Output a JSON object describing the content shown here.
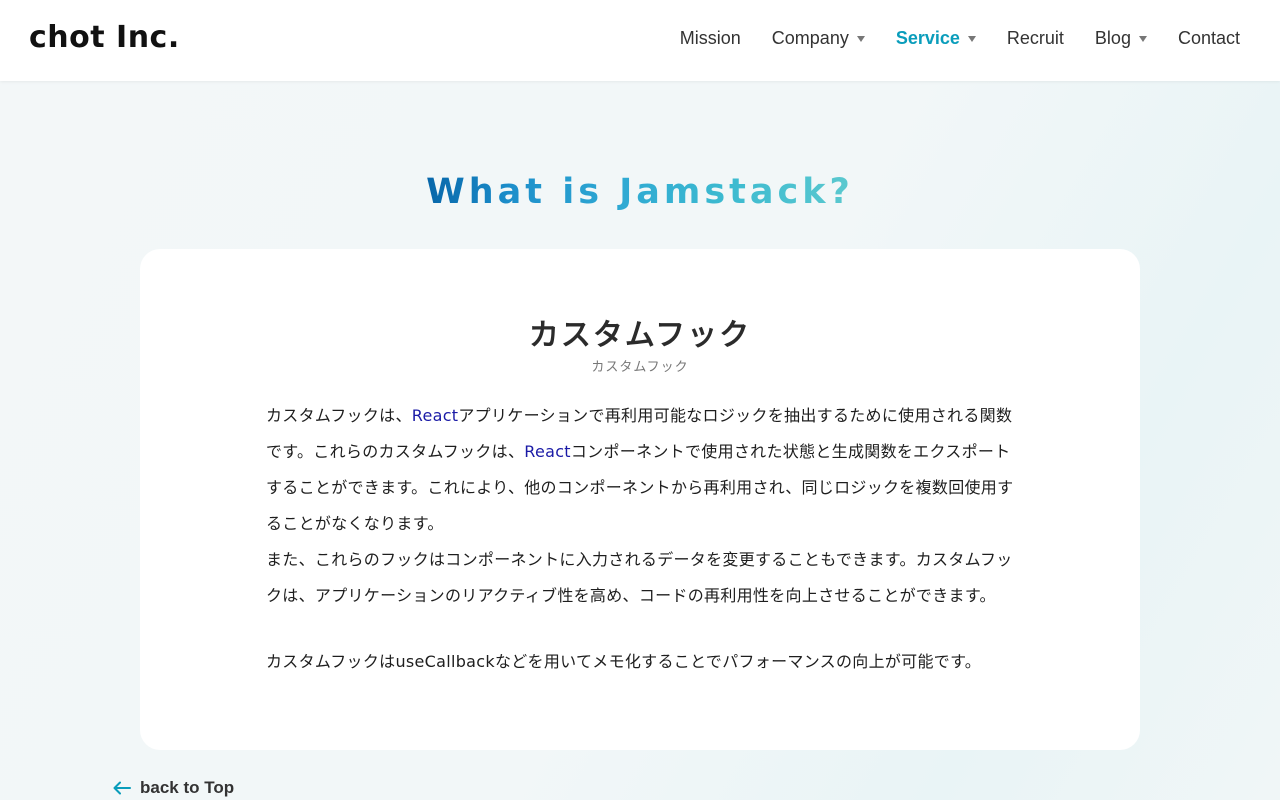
{
  "header": {
    "logo": "chot Inc.",
    "nav": [
      {
        "label": "Mission",
        "dropdown": false,
        "active": false
      },
      {
        "label": "Company",
        "dropdown": true,
        "active": false
      },
      {
        "label": "Service",
        "dropdown": true,
        "active": true
      },
      {
        "label": "Recruit",
        "dropdown": false,
        "active": false
      },
      {
        "label": "Blog",
        "dropdown": true,
        "active": false
      },
      {
        "label": "Contact",
        "dropdown": false,
        "active": false
      }
    ]
  },
  "hero": {
    "title": "What is Jamstack?"
  },
  "article": {
    "title": "カスタムフック",
    "subtitle": "カスタムフック",
    "p1_seg1": "カスタムフックは、",
    "p1_link1": "React",
    "p1_seg2": "アプリケーションで再利用可能なロジックを抽出するために使用される関数です。これらのカスタムフックは、",
    "p1_link2": "React",
    "p1_seg3": "コンポーネントで使用された状態と生成関数をエクスポートすることができます。これにより、他のコンポーネントから再利用され、同じロジックを複数回使用することがなくなります。",
    "p2": "また、これらのフックはコンポーネントに入力されるデータを変更することもできます。カスタムフックは、アプリケーションのリアクティブ性を高め、コードの再利用性を向上させることができます。",
    "p3": "カスタムフックはuseCallbackなどを用いてメモ化することでパフォーマンスの向上が可能です。"
  },
  "footer_nav": {
    "back_label": "back to Top"
  },
  "colors": {
    "accent": "#0a9dbb",
    "link": "#1a1aa6"
  }
}
